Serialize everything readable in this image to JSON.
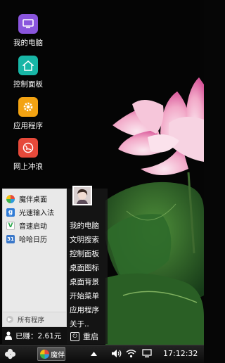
{
  "desktop": {
    "icons": [
      {
        "label": "我的电脑",
        "icon": "monitor-icon",
        "color": "#8a55dd"
      },
      {
        "label": "控制面板",
        "icon": "home-icon",
        "color": "#18b6a6"
      },
      {
        "label": "应用程序",
        "icon": "gear-icon",
        "color": "#f3a312"
      },
      {
        "label": "网上冲浪",
        "icon": "globe-icon",
        "color": "#e6493a"
      }
    ]
  },
  "start_menu": {
    "programs": [
      {
        "label": "魔伴桌面",
        "icon": "pinwheel-icon"
      },
      {
        "label": "光速输入法",
        "icon": "keyboard-g-icon"
      },
      {
        "label": "音速启动",
        "icon": "v-launcher-icon"
      },
      {
        "label": "哈哈日历",
        "icon": "calendar-icon"
      }
    ],
    "all_programs": "所有程序",
    "earned": "已赚：2.61元",
    "system_items": [
      "我的电脑",
      "文明搜索",
      "控制面板",
      "桌面图标",
      "桌面背景",
      "开始菜单",
      "应用程序",
      "关于.."
    ],
    "restart": "重启"
  },
  "taskbar": {
    "app_label": "魔伴",
    "clock": "17:12:32"
  }
}
